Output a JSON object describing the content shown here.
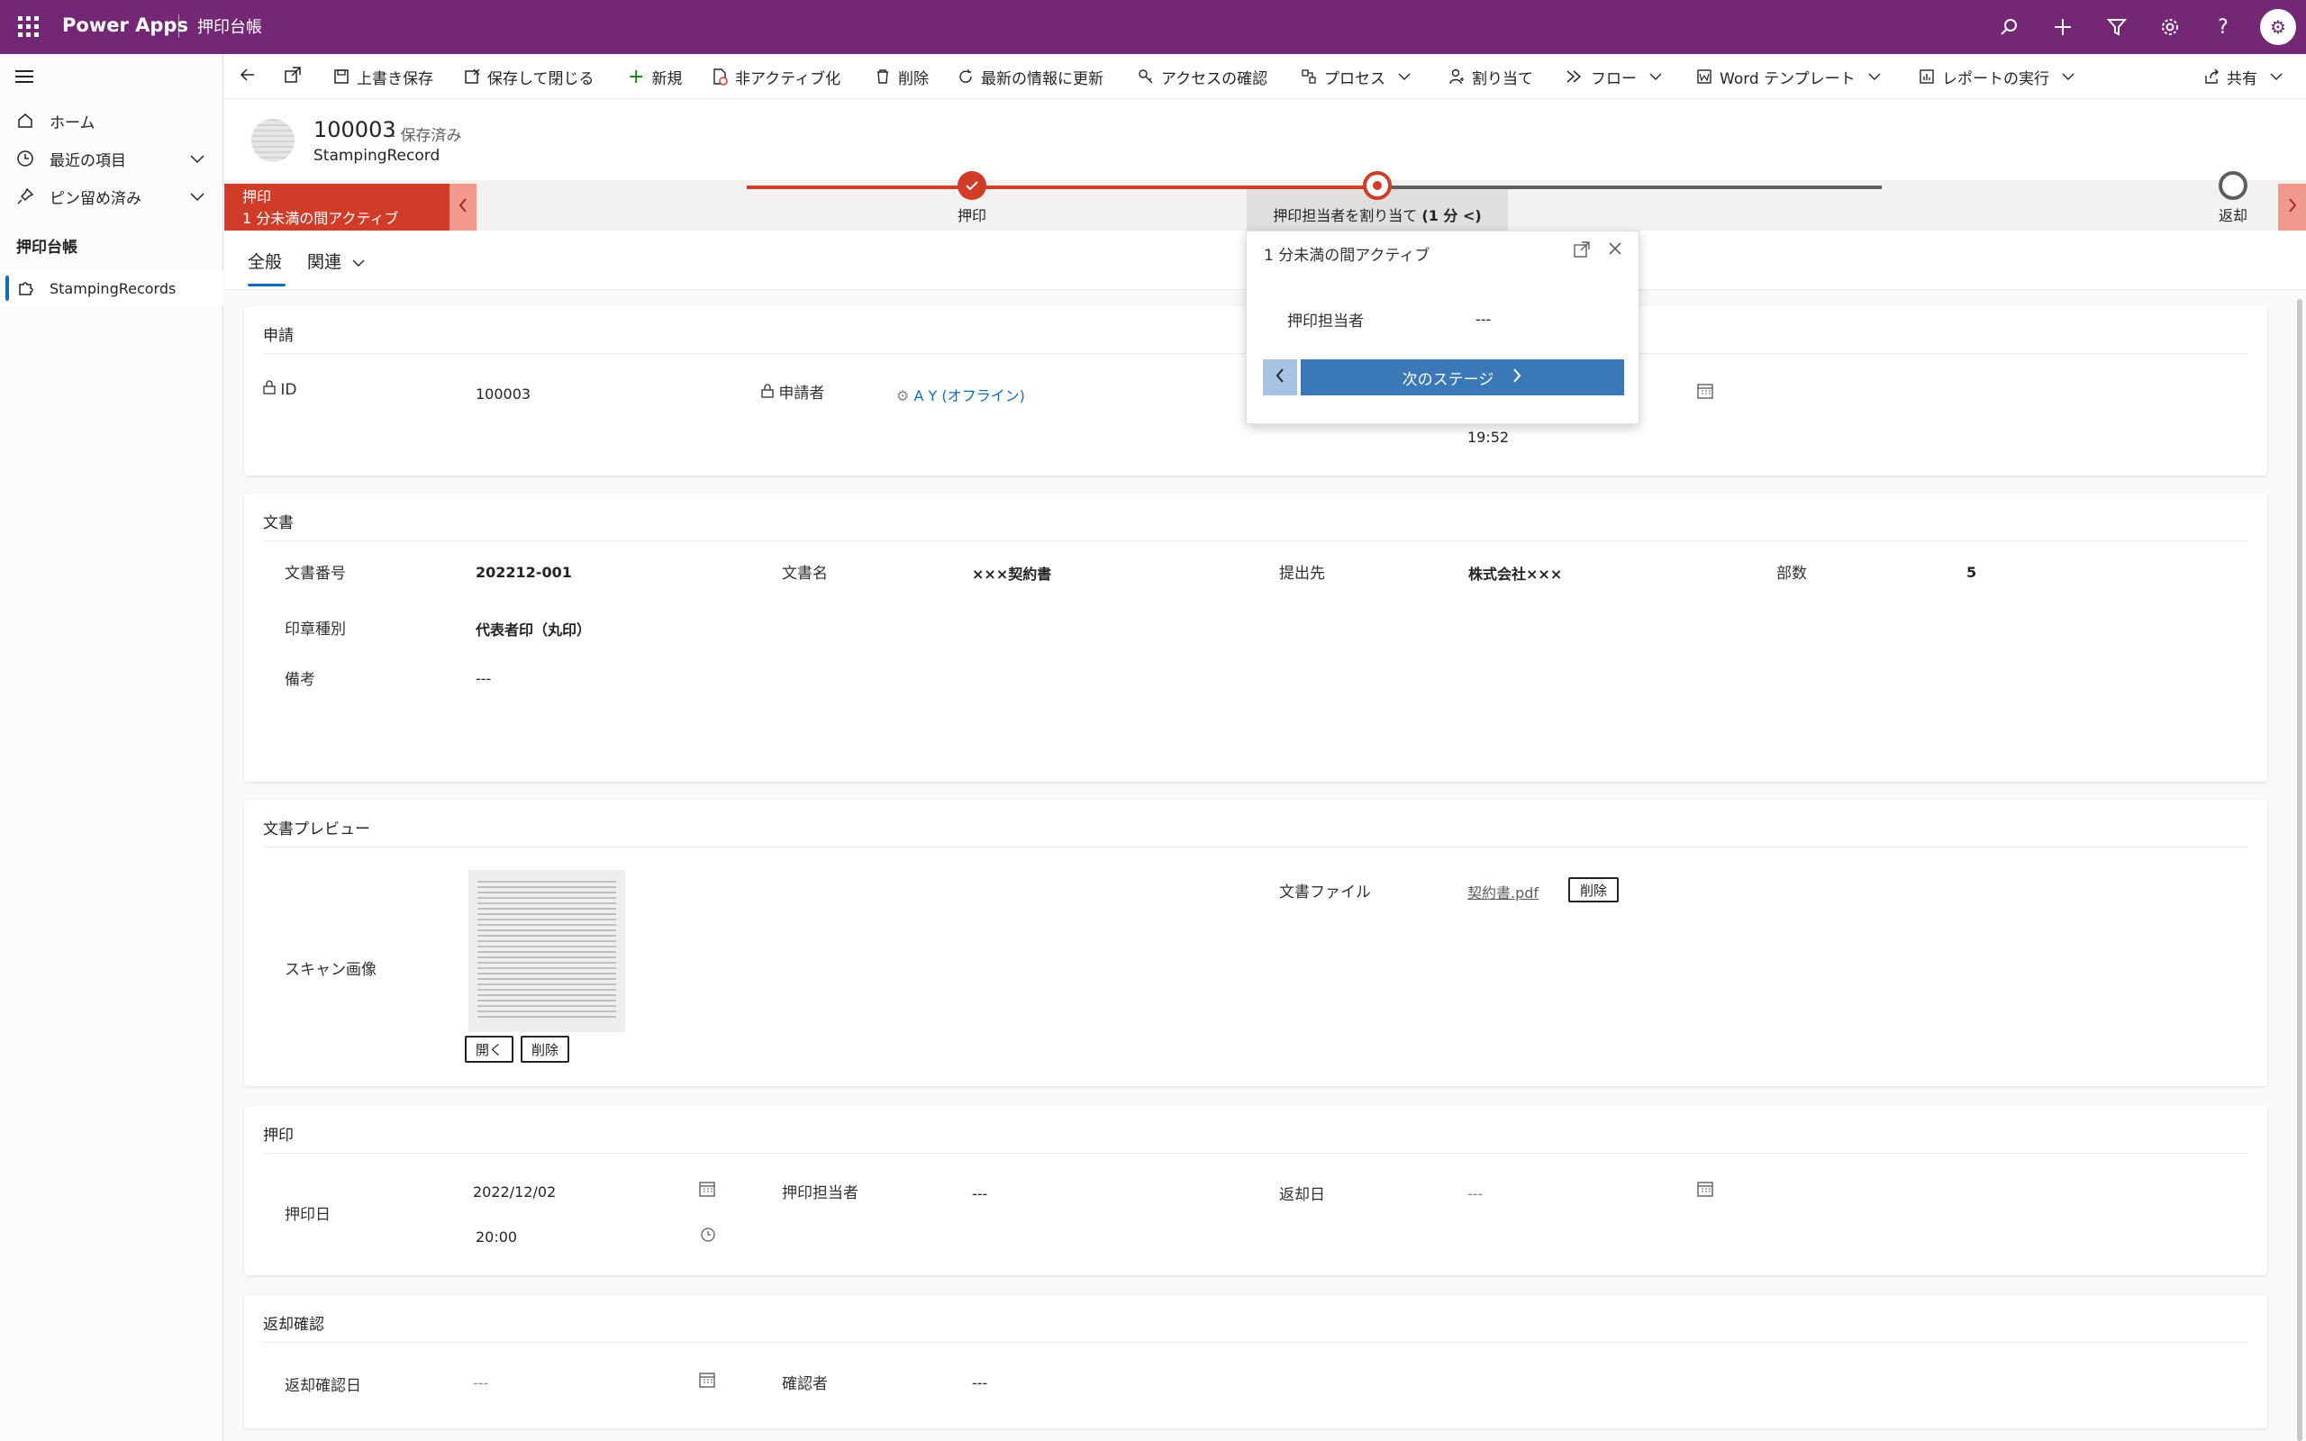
{
  "topbar": {
    "app_name": "Power Apps",
    "env_name": "押印台帳",
    "icons": [
      "search-icon",
      "plus-icon",
      "filter-icon",
      "settings-icon",
      "help-icon",
      "avatar-icon"
    ],
    "brand_color": "#742774"
  },
  "sidebar": {
    "items": [
      {
        "label": "ホーム",
        "icon": "home-icon"
      },
      {
        "label": "最近の項目",
        "icon": "clock-icon"
      },
      {
        "label": "ピン留め済み",
        "icon": "pin-icon"
      }
    ],
    "group_label": "押印台帳",
    "entity_label": "StampingRecords"
  },
  "commandbar": {
    "save": "上書き保存",
    "save_close": "保存して閉じる",
    "new": "新規",
    "deactivate": "非アクティブ化",
    "delete": "削除",
    "refresh": "最新の情報に更新",
    "check_access": "アクセスの確認",
    "process": "プロセス",
    "assign": "割り当て",
    "flow": "フロー",
    "word_template": "Word テンプレート",
    "run_report": "レポートの実行",
    "share": "共有"
  },
  "header": {
    "record_id": "100003",
    "saved_status": "- 保存済み",
    "entity_name": "StampingRecord"
  },
  "bpf": {
    "active_stage_name": "押印",
    "active_stage_duration": "1 分未満の間アクティブ",
    "stages": [
      {
        "label": "押印",
        "state": "done"
      },
      {
        "label": "押印担当者を割り当て",
        "extra": "(1 分 <)",
        "state": "current"
      },
      {
        "label": "返却",
        "state": "pending"
      }
    ],
    "accent_color": "#d13c28"
  },
  "tabs": {
    "general": "全般",
    "related": "関連"
  },
  "flyout": {
    "title": "1 分未満の間アクティブ",
    "field_label": "押印担当者",
    "field_value": "---",
    "next_stage": "次のステージ"
  },
  "sections": {
    "request": {
      "title": "申請",
      "id_label": "ID",
      "id_value": "100003",
      "applicant_label": "申請者",
      "applicant_value": "A Y (オフライン)",
      "time_value": "19:52"
    },
    "document": {
      "title": "文書",
      "doc_no_label": "文書番号",
      "doc_no_value": "202212-001",
      "doc_name_label": "文書名",
      "doc_name_value": "×××契約書",
      "submit_label": "提出先",
      "submit_value": "株式会社×××",
      "copies_label": "部数",
      "copies_value": "5",
      "seal_label": "印章種別",
      "seal_value": "代表者印（丸印）",
      "note_label": "備考",
      "note_value": "---"
    },
    "preview": {
      "title": "文書プレビュー",
      "scan_label": "スキャン画像",
      "open_button": "開く",
      "delete_button": "削除",
      "file_label": "文書ファイル",
      "file_name": "契約書.pdf",
      "file_delete_button": "削除"
    },
    "stamp": {
      "title": "押印",
      "date_label": "押印日",
      "date_value": "2022/12/02",
      "time_value": "20:00",
      "owner_label": "押印担当者",
      "owner_value": "---",
      "return_label": "返却日",
      "return_value": "---"
    },
    "return_check": {
      "title": "返却確認",
      "date_label": "返却確認日",
      "date_value": "---",
      "checker_label": "確認者",
      "checker_value": "---"
    }
  }
}
